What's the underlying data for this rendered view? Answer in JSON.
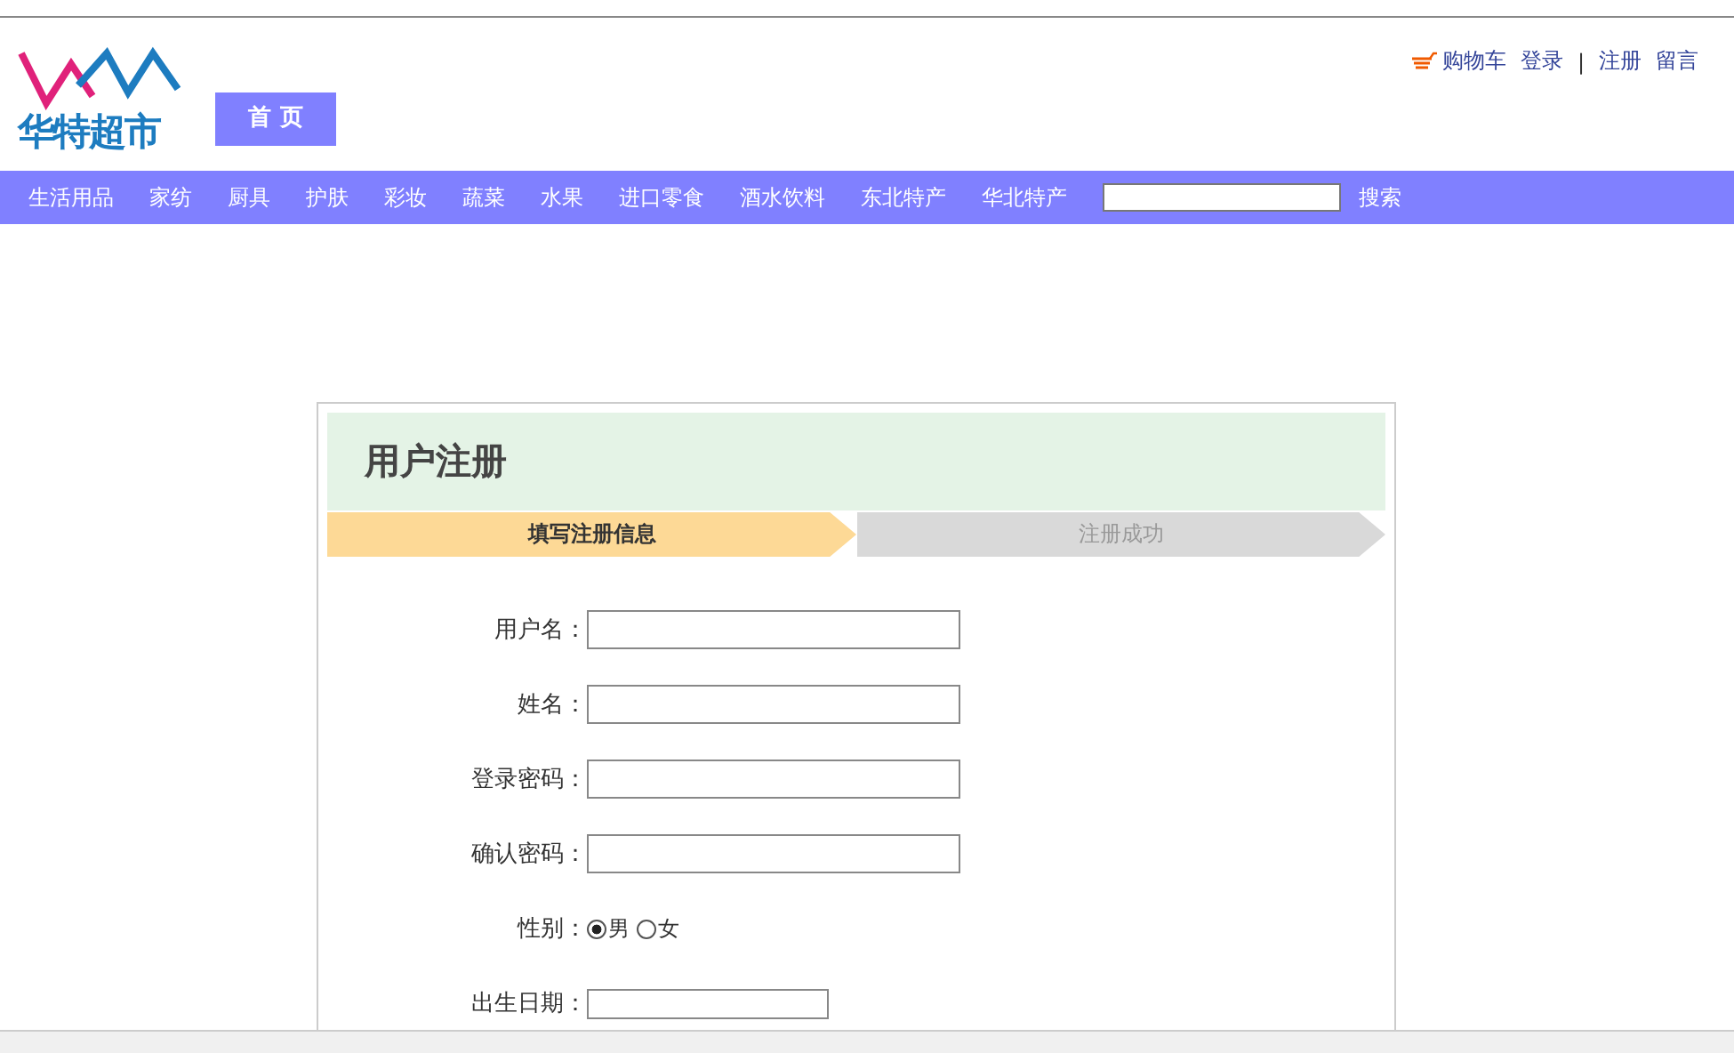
{
  "header": {
    "logo_text": "华特超市",
    "home_tab": "首 页",
    "links": [
      {
        "kind": "cart",
        "label": "购物车"
      },
      {
        "kind": "link",
        "label": "登录"
      },
      {
        "kind": "separator",
        "label": "|"
      },
      {
        "kind": "link",
        "label": "注册"
      },
      {
        "kind": "link",
        "label": "留言"
      }
    ]
  },
  "nav": {
    "items": [
      "生活用品",
      "家纺",
      "厨具",
      "护肤",
      "彩妆",
      "蔬菜",
      "水果",
      "进口零食",
      "酒水饮料",
      "东北特产",
      "华北特产"
    ],
    "search_button": "搜索"
  },
  "register": {
    "title": "用户注册",
    "steps": [
      {
        "label": "填写注册信息",
        "selected": true
      },
      {
        "label": "注册成功",
        "selected": false
      }
    ],
    "fields": [
      {
        "kind": "text",
        "label": "用户名："
      },
      {
        "kind": "text",
        "label": "姓名："
      },
      {
        "kind": "text",
        "label": "登录密码："
      },
      {
        "kind": "text",
        "label": "确认密码："
      },
      {
        "kind": "radio",
        "label": "性别：",
        "options": [
          {
            "label": "男",
            "selected": true
          },
          {
            "label": "女",
            "selected": false
          }
        ]
      },
      {
        "kind": "date",
        "label": "出生日期："
      }
    ]
  }
}
